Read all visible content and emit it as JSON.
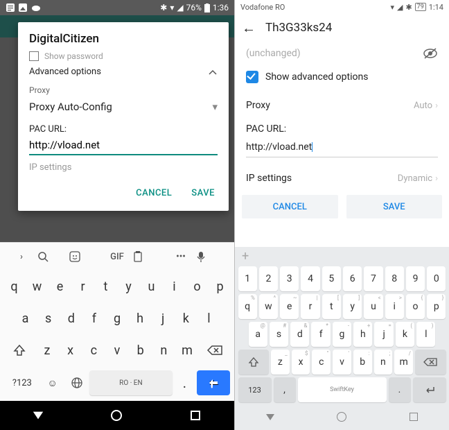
{
  "left": {
    "status": {
      "battery": "76%",
      "time": "1:36"
    },
    "dialog": {
      "title": "DigitalCitizen",
      "show_password": "Show password",
      "advanced": "Advanced options",
      "proxy_label": "Proxy",
      "proxy_value": "Proxy Auto-Config",
      "pac_label": "PAC URL:",
      "pac_value": "http://vload.net",
      "ip_label": "IP settings",
      "cancel": "CANCEL",
      "save": "SAVE"
    },
    "kb": {
      "gif": "GIF",
      "r1": [
        "q",
        "w",
        "e",
        "r",
        "t",
        "y",
        "u",
        "i",
        "o",
        "p"
      ],
      "r2": [
        "a",
        "s",
        "d",
        "f",
        "g",
        "h",
        "j",
        "k",
        "l"
      ],
      "r3": [
        "z",
        "x",
        "c",
        "v",
        "b",
        "n",
        "m"
      ],
      "sym": "?123",
      "space": "RO · EN"
    }
  },
  "right": {
    "status": {
      "carrier": "Vodafone RO",
      "battery": "79",
      "time": "1:14"
    },
    "title": "Th3G33ks24",
    "unchanged": "(unchanged)",
    "show_adv": "Show advanced options",
    "proxy_label": "Proxy",
    "proxy_value": "Auto",
    "pac_label": "PAC URL:",
    "pac_value": "http://vload.net",
    "ip_label": "IP settings",
    "ip_value": "Dynamic",
    "cancel": "CANCEL",
    "save": "SAVE",
    "kb": {
      "num": [
        "1",
        "2",
        "3",
        "4",
        "5",
        "6",
        "7",
        "8",
        "9",
        "0"
      ],
      "r1": [
        [
          "q",
          "%"
        ],
        [
          "w",
          "^"
        ],
        [
          "e",
          "~"
        ],
        [
          "r",
          "|"
        ],
        [
          "t",
          "["
        ],
        [
          "y",
          "]"
        ],
        [
          "u",
          "<"
        ],
        [
          "i",
          ">"
        ],
        [
          "o",
          "{"
        ],
        [
          "p",
          "}"
        ]
      ],
      "r2": [
        [
          "a",
          "@"
        ],
        [
          "s",
          "#"
        ],
        [
          "d",
          "&"
        ],
        [
          "f",
          "*"
        ],
        [
          "g",
          "-"
        ],
        [
          "h",
          "+"
        ],
        [
          "j",
          "="
        ],
        [
          "k",
          "("
        ],
        [
          "l",
          ")"
        ]
      ],
      "r3": [
        [
          "z",
          "_"
        ],
        [
          "x",
          "$"
        ],
        [
          "c",
          "\""
        ],
        [
          "v",
          "'"
        ],
        [
          "b",
          ":"
        ],
        [
          "n",
          ";"
        ],
        [
          "m",
          "/"
        ]
      ],
      "num_key": "123",
      "space": "SwiftKey"
    }
  }
}
